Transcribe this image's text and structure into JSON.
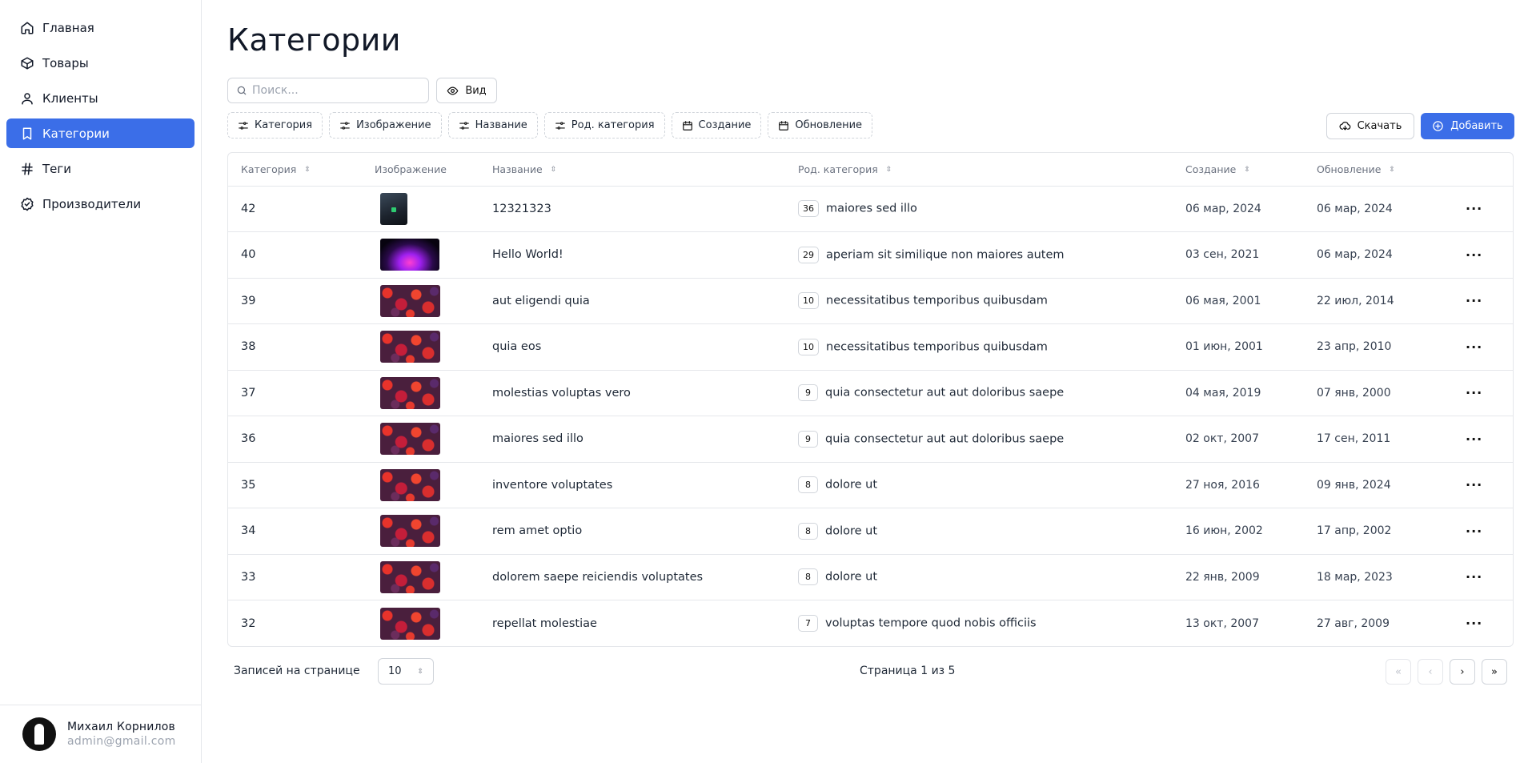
{
  "sidebar": {
    "items": [
      {
        "label": "Главная",
        "icon": "home-icon"
      },
      {
        "label": "Товары",
        "icon": "box-icon"
      },
      {
        "label": "Клиенты",
        "icon": "user-icon"
      },
      {
        "label": "Категории",
        "icon": "bookmark-icon",
        "active": true
      },
      {
        "label": "Теги",
        "icon": "hash-icon"
      },
      {
        "label": "Производители",
        "icon": "badge-check-icon"
      }
    ],
    "user": {
      "name": "Михаил Корнилов",
      "email": "admin@gmail.com"
    }
  },
  "main": {
    "title": "Категории",
    "search": {
      "placeholder": "Поиск...",
      "value": ""
    },
    "view_label": "Вид",
    "filters": [
      {
        "label": "Категория",
        "icon": "sliders-icon"
      },
      {
        "label": "Изображение",
        "icon": "sliders-icon"
      },
      {
        "label": "Название",
        "icon": "sliders-icon"
      },
      {
        "label": "Род. категория",
        "icon": "sliders-icon"
      },
      {
        "label": "Создание",
        "icon": "calendar-icon"
      },
      {
        "label": "Обновление",
        "icon": "calendar-icon"
      }
    ],
    "download_label": "Скачать",
    "add_label": "Добавить",
    "table": {
      "columns": [
        "Категория",
        "Изображение",
        "Название",
        "Род. категория",
        "Создание",
        "Обновление"
      ],
      "rows": [
        {
          "id": "42",
          "image": "dark",
          "name": "12321323",
          "parent_id": "36",
          "parent_name": "maiores sed illo",
          "created": "06 мар, 2024",
          "updated": "06 мар, 2024"
        },
        {
          "id": "40",
          "image": "neon",
          "name": "Hello World!",
          "parent_id": "29",
          "parent_name": "aperiam sit similique non maiores autem",
          "created": "03 сен, 2021",
          "updated": "06 мар, 2024"
        },
        {
          "id": "39",
          "image": "berries",
          "name": "aut eligendi quia",
          "parent_id": "10",
          "parent_name": "necessitatibus temporibus quibusdam",
          "created": "06 мая, 2001",
          "updated": "22 июл, 2014"
        },
        {
          "id": "38",
          "image": "berries",
          "name": "quia eos",
          "parent_id": "10",
          "parent_name": "necessitatibus temporibus quibusdam",
          "created": "01 июн, 2001",
          "updated": "23 апр, 2010"
        },
        {
          "id": "37",
          "image": "berries",
          "name": "molestias voluptas vero",
          "parent_id": "9",
          "parent_name": "quia consectetur aut aut doloribus saepe",
          "created": "04 мая, 2019",
          "updated": "07 янв, 2000"
        },
        {
          "id": "36",
          "image": "berries",
          "name": "maiores sed illo",
          "parent_id": "9",
          "parent_name": "quia consectetur aut aut doloribus saepe",
          "created": "02 окт, 2007",
          "updated": "17 сен, 2011"
        },
        {
          "id": "35",
          "image": "berries",
          "name": "inventore voluptates",
          "parent_id": "8",
          "parent_name": "dolore ut",
          "created": "27 ноя, 2016",
          "updated": "09 янв, 2024"
        },
        {
          "id": "34",
          "image": "berries",
          "name": "rem amet optio",
          "parent_id": "8",
          "parent_name": "dolore ut",
          "created": "16 июн, 2002",
          "updated": "17 апр, 2002"
        },
        {
          "id": "33",
          "image": "berries",
          "name": "dolorem saepe reiciendis voluptates",
          "parent_id": "8",
          "parent_name": "dolore ut",
          "created": "22 янв, 2009",
          "updated": "18 мар, 2023"
        },
        {
          "id": "32",
          "image": "berries",
          "name": "repellat molestiae",
          "parent_id": "7",
          "parent_name": "voluptas tempore quod nobis officiis",
          "created": "13 окт, 2007",
          "updated": "27 авг, 2009"
        }
      ],
      "row_actions_label": "···"
    },
    "pagination": {
      "rows_per_page_label": "Записей на странице",
      "rows_per_page_value": "10",
      "page_info": "Страница 1 из 5",
      "first_label": "«",
      "prev_label": "‹",
      "next_label": "›",
      "last_label": "»"
    }
  },
  "colors": {
    "accent": "#3b6ee8",
    "border": "#e5e7eb",
    "muted_text": "#6b7280"
  }
}
